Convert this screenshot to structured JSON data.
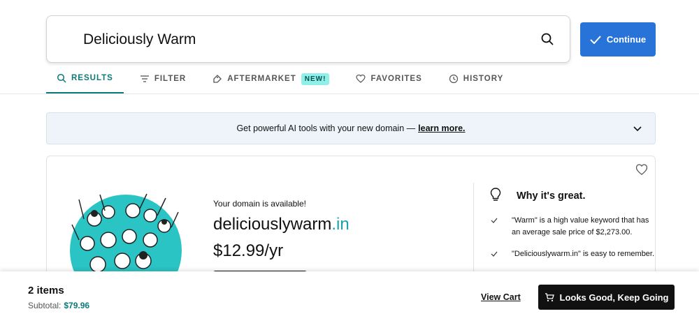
{
  "search": {
    "value": "Deliciously Warm"
  },
  "continue_button": {
    "label": "Continue"
  },
  "tabs": [
    {
      "label": "RESULTS",
      "icon": "search-icon",
      "active": true
    },
    {
      "label": "FILTER",
      "icon": "filter-icon"
    },
    {
      "label": "AFTERMARKET",
      "icon": "tag-icon",
      "badge": "NEW!"
    },
    {
      "label": "FAVORITES",
      "icon": "heart-icon"
    },
    {
      "label": "HISTORY",
      "icon": "history-icon"
    }
  ],
  "banner": {
    "text": "Get powerful AI tools with your new domain —",
    "link": "learn more."
  },
  "result": {
    "availability": "Your domain is available!",
    "domain_base": "deliciouslywarm",
    "domain_tld": ".in",
    "price": "$12.99/yr"
  },
  "why": {
    "title": "Why it's great.",
    "reasons": [
      "\"Warm\" is a high value keyword that has an average sale price of $2,273.00.",
      "\"Deliciouslywarm.in\" is easy to remember."
    ]
  },
  "footer": {
    "items": "2 items",
    "subtotal_label": "Subtotal:",
    "subtotal_value": "$79.96",
    "view_cart": "View Cart",
    "keep_going": "Looks Good, Keep Going"
  },
  "colors": {
    "accent": "#2873d8",
    "teal": "#0b7a7b",
    "tld": "#1aa2a8",
    "badge": "#8ff0ea"
  }
}
